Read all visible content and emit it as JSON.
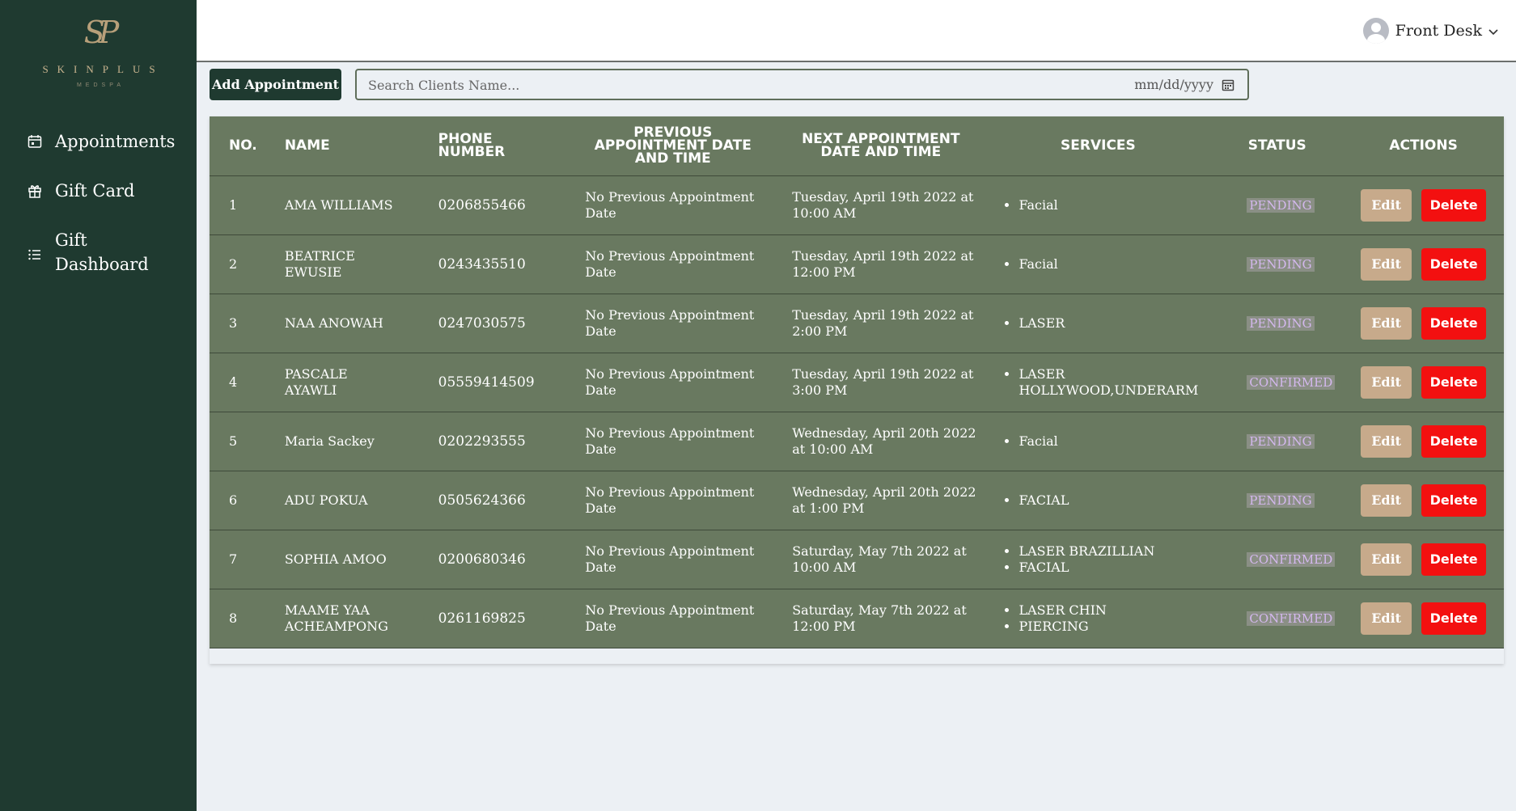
{
  "brand": {
    "mark": "SP",
    "name": "SKINPLUS",
    "sub": "MEDSPA"
  },
  "sidebar": {
    "items": [
      {
        "label": "Appointments",
        "icon": "calendar-icon"
      },
      {
        "label": "Gift Card",
        "icon": "gift-icon"
      },
      {
        "label": "Gift Dashboard",
        "icon": "list-icon"
      }
    ]
  },
  "header": {
    "user_label": "Front Desk"
  },
  "toolbar": {
    "add_label": "Add Appointment",
    "search_placeholder": "Search Clients Name...",
    "date_placeholder": "mm/dd/yyyy"
  },
  "table": {
    "headers": {
      "no": "NO.",
      "name": "NAME",
      "phone": "PHONE NUMBER",
      "previous": "PREVIOUS APPOINTMENT DATE AND TIME",
      "next": "NEXT APPOINTMENT DATE AND TIME",
      "services": "SERVICES",
      "status": "STATUS",
      "actions": "ACTIONS"
    },
    "edit_label": "Edit",
    "delete_label": "Delete",
    "rows": [
      {
        "no": "1",
        "name": "AMA WILLIAMS",
        "phone": "0206855466",
        "previous": "No Previous Appointment Date",
        "next": "Tuesday, April 19th 2022 at 10:00 AM",
        "services": [
          "Facial"
        ],
        "status": "PENDING"
      },
      {
        "no": "2",
        "name": "BEATRICE EWUSIE",
        "phone": "0243435510",
        "previous": "No Previous Appointment Date",
        "next": "Tuesday, April 19th 2022 at 12:00 PM",
        "services": [
          "Facial"
        ],
        "status": "PENDING"
      },
      {
        "no": "3",
        "name": "NAA ANOWAH",
        "phone": "0247030575",
        "previous": "No Previous Appointment Date",
        "next": "Tuesday, April 19th 2022 at 2:00 PM",
        "services": [
          "LASER"
        ],
        "status": "PENDING"
      },
      {
        "no": "4",
        "name": "PASCALE AYAWLI",
        "phone": "05559414509",
        "previous": "No Previous Appointment Date",
        "next": "Tuesday, April 19th 2022 at 3:00 PM",
        "services": [
          "LASER HOLLYWOOD,UNDERARM"
        ],
        "status": "CONFIRMED"
      },
      {
        "no": "5",
        "name": "Maria Sackey",
        "phone": "0202293555",
        "previous": "No Previous Appointment Date",
        "next": "Wednesday, April 20th 2022 at 10:00 AM",
        "services": [
          "Facial"
        ],
        "status": "PENDING"
      },
      {
        "no": "6",
        "name": "ADU POKUA",
        "phone": "0505624366",
        "previous": "No Previous Appointment Date",
        "next": "Wednesday, April 20th 2022 at 1:00 PM",
        "services": [
          "FACIAL"
        ],
        "status": "PENDING"
      },
      {
        "no": "7",
        "name": "SOPHIA AMOO",
        "phone": "0200680346",
        "previous": "No Previous Appointment Date",
        "next": "Saturday, May 7th 2022 at 10:00 AM",
        "services": [
          "LASER BRAZILLIAN",
          "FACIAL"
        ],
        "status": "CONFIRMED"
      },
      {
        "no": "8",
        "name": "MAAME YAA ACHEAMPONG",
        "phone": "0261169825",
        "previous": "No Previous Appointment Date",
        "next": "Saturday, May 7th 2022 at 12:00 PM",
        "services": [
          "LASER CHIN",
          "PIERCING"
        ],
        "status": "CONFIRMED"
      }
    ]
  },
  "colors": {
    "sidebar_bg": "#1f3a30",
    "table_bg": "#697960",
    "edit_btn": "#c7aa8b",
    "delete_btn": "#f31010",
    "badge_text": "#d4b8ee"
  }
}
